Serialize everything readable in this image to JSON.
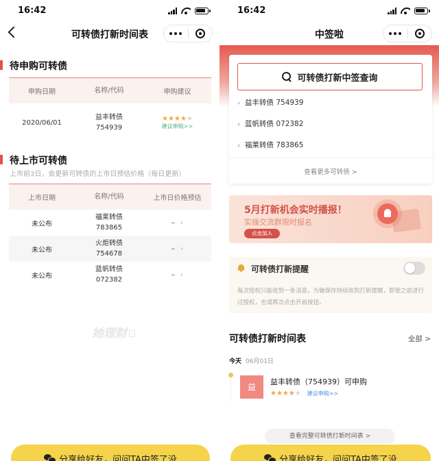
{
  "left": {
    "status_time": "16:42",
    "nav_title": "可转债打新时间表",
    "pending": {
      "title": "待申购可转债",
      "columns": [
        "申购日期",
        "名称/代码",
        "申购建议"
      ],
      "rows": [
        {
          "date": "2020/06/01",
          "name": "益丰转债",
          "code": "754939",
          "stars": 4,
          "advice": "建议申购>>"
        }
      ]
    },
    "listing": {
      "title": "待上市可转债",
      "subtitle": "上市前3日，会更新可转债的上市日预估价格（每日更新）",
      "columns": [
        "上市日期",
        "名称/代码",
        "上市日价格预估"
      ],
      "rows": [
        {
          "date": "未公布",
          "name": "福莱转债",
          "code": "783865",
          "price": "–"
        },
        {
          "date": "未公布",
          "name": "火炬转债",
          "code": "754678",
          "price": "–"
        },
        {
          "date": "未公布",
          "name": "蓝帆转债",
          "code": "072382",
          "price": "–"
        }
      ]
    },
    "watermark": "她理财",
    "share_label": "分享给好友，问问TA中签了没"
  },
  "right": {
    "status_time": "16:42",
    "nav_title": "中签啦",
    "query_label": "可转债打新中签查询",
    "bonds": [
      "益丰转债 754939",
      "蓝帆转债 072382",
      "福莱转债 783865"
    ],
    "more_label": "查看更多可转债 >",
    "promo": {
      "title": "5月打新机会实时播报！",
      "subtitle": "实操交流群限时报名",
      "button": "点击加入"
    },
    "remind": {
      "title": "可转债打新提醒",
      "desc": "每次授权只能收到一条消息，为确保你持续收到打新提醒，即使之前进行过授权，也请再次点击开启按钮。",
      "enabled": false
    },
    "schedule": {
      "title": "可转债打新时间表",
      "all_label": "全部 >",
      "today_label": "今天",
      "today_date": "06月01日",
      "item": {
        "badge": "益",
        "name": "益丰转债（754939）可申购",
        "stars": 4,
        "advice": "建议申购>>"
      }
    },
    "full_link": "查看完整可转债打新时间表 >",
    "share_label": "分享给好友，问问TA中签了没"
  }
}
